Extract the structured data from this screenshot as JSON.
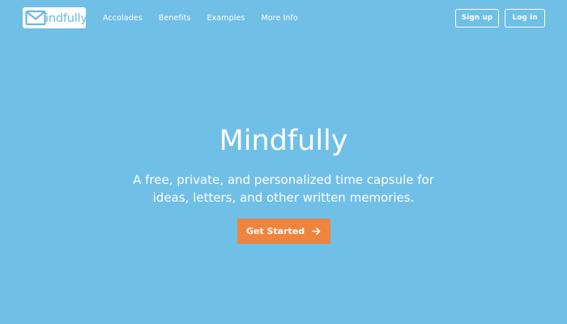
{
  "brand": {
    "logo_text": "indfully",
    "logo_icon": "envelope-m-icon",
    "logo_color": "#6cb7e0"
  },
  "nav": {
    "links": [
      {
        "label": "Accolades"
      },
      {
        "label": "Benefits"
      },
      {
        "label": "Examples"
      },
      {
        "label": "More Info"
      }
    ],
    "signup_label": "Sign up",
    "login_label": "Log in"
  },
  "hero": {
    "title": "Mindfully",
    "subtitle": "A free, private, and personalized time capsule for ideas, letters, and other written memories.",
    "cta_label": "Get Started",
    "cta_icon": "arrow-right-icon"
  },
  "colors": {
    "background": "#70bfe7",
    "accent": "#ee843e",
    "text": "#ffffff"
  }
}
